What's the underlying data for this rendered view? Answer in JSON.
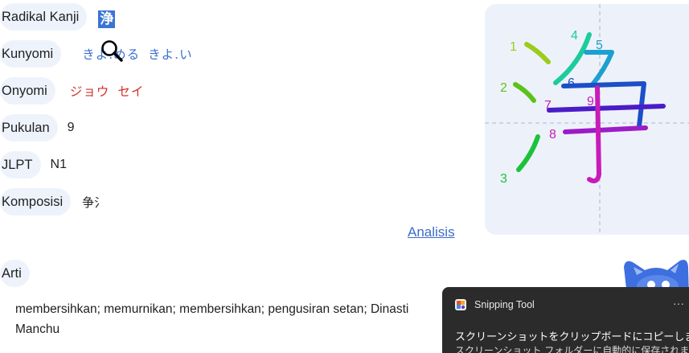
{
  "info": {
    "radical": {
      "label": "Radikal Kanji",
      "value": "浄"
    },
    "kunyomi": {
      "label": "Kunyomi",
      "readings": [
        "きよ.める",
        "きよ.い"
      ]
    },
    "onyomi": {
      "label": "Onyomi",
      "readings": [
        "ジョウ",
        "セイ"
      ]
    },
    "strokes": {
      "label": "Pukulan",
      "value": "9"
    },
    "jlpt": {
      "label": "JLPT",
      "value": "N1"
    },
    "composition": {
      "label": "Komposisi",
      "value": "争氵"
    }
  },
  "analysis_link": "Analisis",
  "meaning": {
    "label": "Arti",
    "text": "membersihkan; memurnikan; membersihkan; pengusiran setan; Dinasti Manchu"
  },
  "stroke_order": {
    "numbers": [
      "1",
      "2",
      "3",
      "4",
      "5",
      "6",
      "7",
      "8",
      "9"
    ],
    "colors": {
      "s1": "#9ccc1a",
      "s2": "#5cc21a",
      "s3": "#1cc23b",
      "s4": "#1ccc9c",
      "s5": "#1ca0d0",
      "s6": "#1c4fc8",
      "s7": "#4a1cc8",
      "s8": "#9c1cc8",
      "s9": "#c81cb8"
    }
  },
  "toast": {
    "app_name": "Snipping Tool",
    "more": "···",
    "line1": "スクリーンショットをクリップボードにコピーしました",
    "line2": "スクリーンショット フォルダーに自動的に保存されました"
  },
  "colors": {
    "pill_bg": "#eef3fb",
    "link": "#3a6fd1",
    "onyomi": "#d1302b",
    "toast_bg": "#2b2b2b"
  }
}
